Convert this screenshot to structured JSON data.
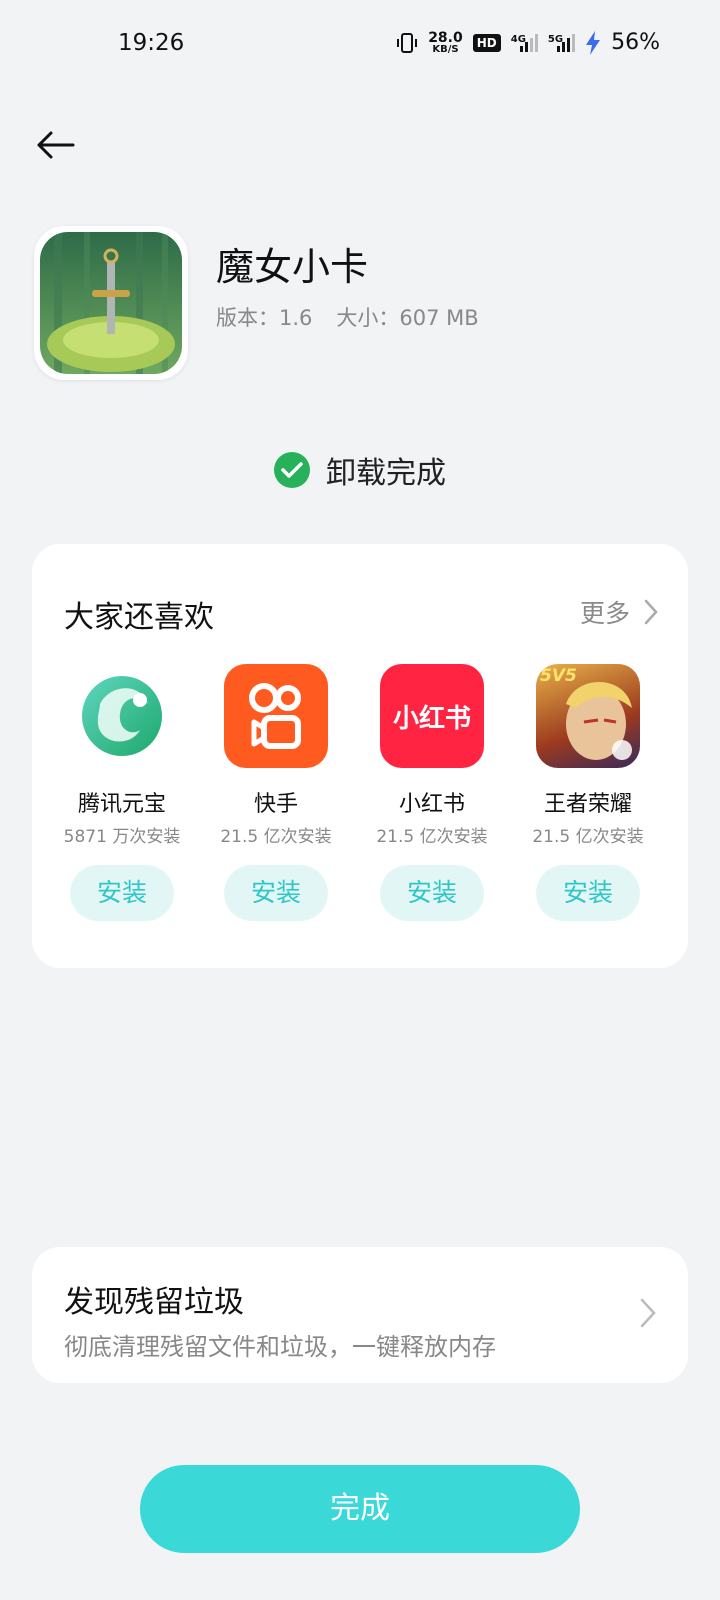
{
  "status_bar": {
    "time": "19:26",
    "net_speed_value": "28.0",
    "net_speed_unit": "KB/S",
    "hd_label": "HD",
    "sim1_tag": "4G",
    "sim2_tag": "5G",
    "battery": "56%"
  },
  "app": {
    "name": "魔女小卡",
    "version": "版本：1.6",
    "size": "大小：607 MB"
  },
  "uninstall": {
    "status": "卸载完成"
  },
  "recommend": {
    "title": "大家还喜欢",
    "more_label": "更多",
    "apps": [
      {
        "name": "腾讯元宝",
        "installs": "5871 万次安装",
        "button": "安装"
      },
      {
        "name": "快手",
        "installs": "21.5 亿次安装",
        "button": "安装"
      },
      {
        "name": "小红书",
        "installs": "21.5 亿次安装",
        "button": "安装",
        "icon_text": "小红书"
      },
      {
        "name": "王者荣耀",
        "installs": "21.5 亿次安装",
        "button": "安装",
        "icon_text": "5V5"
      }
    ]
  },
  "residue": {
    "title": "发现残留垃圾",
    "desc": "彻底清理残留文件和垃圾，一键释放内存"
  },
  "done_button": "完成",
  "colors": {
    "accent": "#3bd8d8",
    "success": "#27b15b",
    "install_bg": "#e3f6f6",
    "install_text": "#2ec6c6"
  }
}
